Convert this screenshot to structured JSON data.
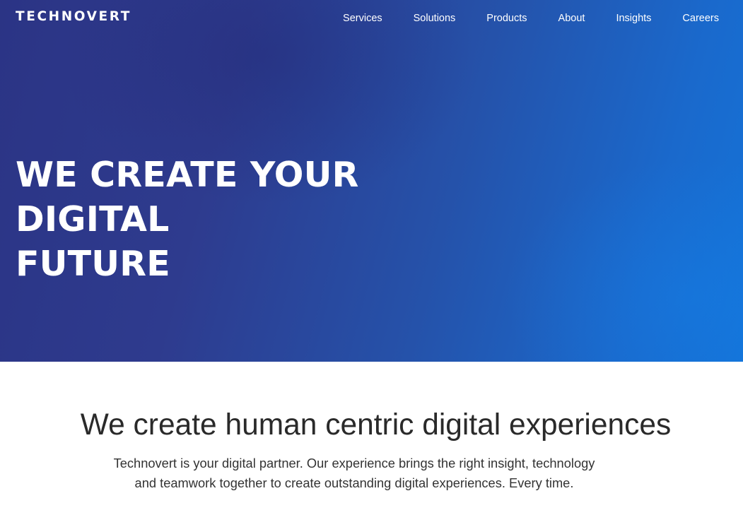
{
  "header": {
    "logo_text": "TECHNOVERT",
    "nav": [
      {
        "label": "Services"
      },
      {
        "label": "Solutions"
      },
      {
        "label": "Products"
      },
      {
        "label": "About"
      },
      {
        "label": "Insights"
      },
      {
        "label": "Careers"
      }
    ]
  },
  "hero": {
    "title_line1": "WE CREATE YOUR DIGITAL",
    "title_line2": "FUTURE"
  },
  "intro": {
    "heading": "We create human centric digital experiences",
    "body": "Technovert is your digital partner. Our experience brings the right insight, technology and teamwork together to create outstanding digital experiences. Every time."
  },
  "colors": {
    "hero_gradient_start": "#2b3485",
    "hero_gradient_end": "#1473d8",
    "text_dark": "#2a2a2a",
    "text_light": "#ffffff"
  }
}
